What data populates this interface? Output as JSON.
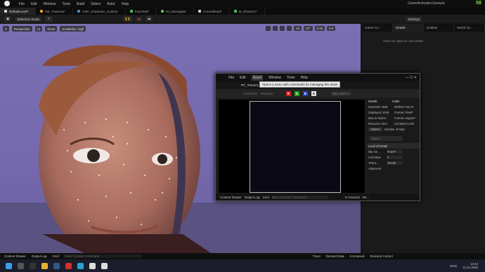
{
  "menu": [
    "File",
    "Edit",
    "Window",
    "Tools",
    "Build",
    "Select",
    "Actor",
    "Help"
  ],
  "project": "GameAnimationSample",
  "fps": "58",
  "tabs": [
    {
      "label": "DefaultLevel*",
      "color": "#dddddd"
    },
    {
      "label": "NS_Traverse*",
      "color": "#e0a020"
    },
    {
      "label": "CSP_Character_Custom",
      "color": "#3a8fd0"
    },
    {
      "label": "FaceTest*",
      "color": "#50c050"
    },
    {
      "label": "M_Unwrapper",
      "color": "#50c050"
    },
    {
      "label": "Curvedhead*",
      "color": "#d0d0d0"
    },
    {
      "label": "M_ShowUV*",
      "color": "#50c050"
    }
  ],
  "toolbar": {
    "mode": "Selection Mode",
    "platforms": "Platforms",
    "settings": "Settings"
  },
  "viewport": {
    "perspective": "Perspective",
    "lit": "Lit",
    "show": "Show",
    "scalability": "Scalability: High",
    "grid": "10",
    "angle": "10°",
    "scale": "0.25",
    "speed": "0.5"
  },
  "right_tabs": [
    "Game An...",
    "Details",
    "Outliner",
    "World Se..."
  ],
  "right_hint": "Select an object to view details",
  "asset_window": {
    "menu": [
      "File",
      "Edit",
      "Asset",
      "Window",
      "Tools",
      "Help"
    ],
    "tooltip": "Opens a menu with commands for managing this asset",
    "tab": "RT_Travers...",
    "tool": [
      "Compress",
      "Reimport"
    ],
    "channels": [
      {
        "l": "R",
        "c": "#c82020"
      },
      {
        "l": "G",
        "c": "#20a020"
      },
      {
        "l": "B",
        "c": "#2040c8"
      },
      {
        "l": "A",
        "c": "#dddddd"
      }
    ],
    "mip": "Mip Level: 0",
    "details": "Details",
    "oodle": "Oodle",
    "rows": [
      [
        "Imported: 2048",
        "Method: Not St"
      ],
      [
        "Displayed: 2048",
        "Format: PixelF"
      ],
      [
        "Max In-Game:",
        "Format: Support"
      ],
      [
        "Resource Size:",
        "Combined LOD"
      ],
      [
        "Detect",
        "Number of Mips"
      ]
    ],
    "search": "Search",
    "section": "Level Of Detail",
    "lod": [
      [
        "Mip Ge...",
        "FromT"
      ],
      [
        "LOD Bias",
        "0"
      ],
      [
        "Textur...",
        "Rende"
      ]
    ],
    "advanced": "Advanced",
    "bottom": [
      "Content Drawer",
      "Output Log",
      "Cmd",
      "Enter Console Command",
      "5 Unsaved",
      "Re..."
    ]
  },
  "bottombar": [
    "Content Drawer",
    "Output Log",
    "Cmd",
    "Enter Console Command",
    "Trace",
    "Derived Data",
    "5 Unsaved",
    "Revision Control"
  ],
  "taskbar": {
    "lang": "ENG",
    "time": "14:44",
    "date": "11.01.2025"
  }
}
